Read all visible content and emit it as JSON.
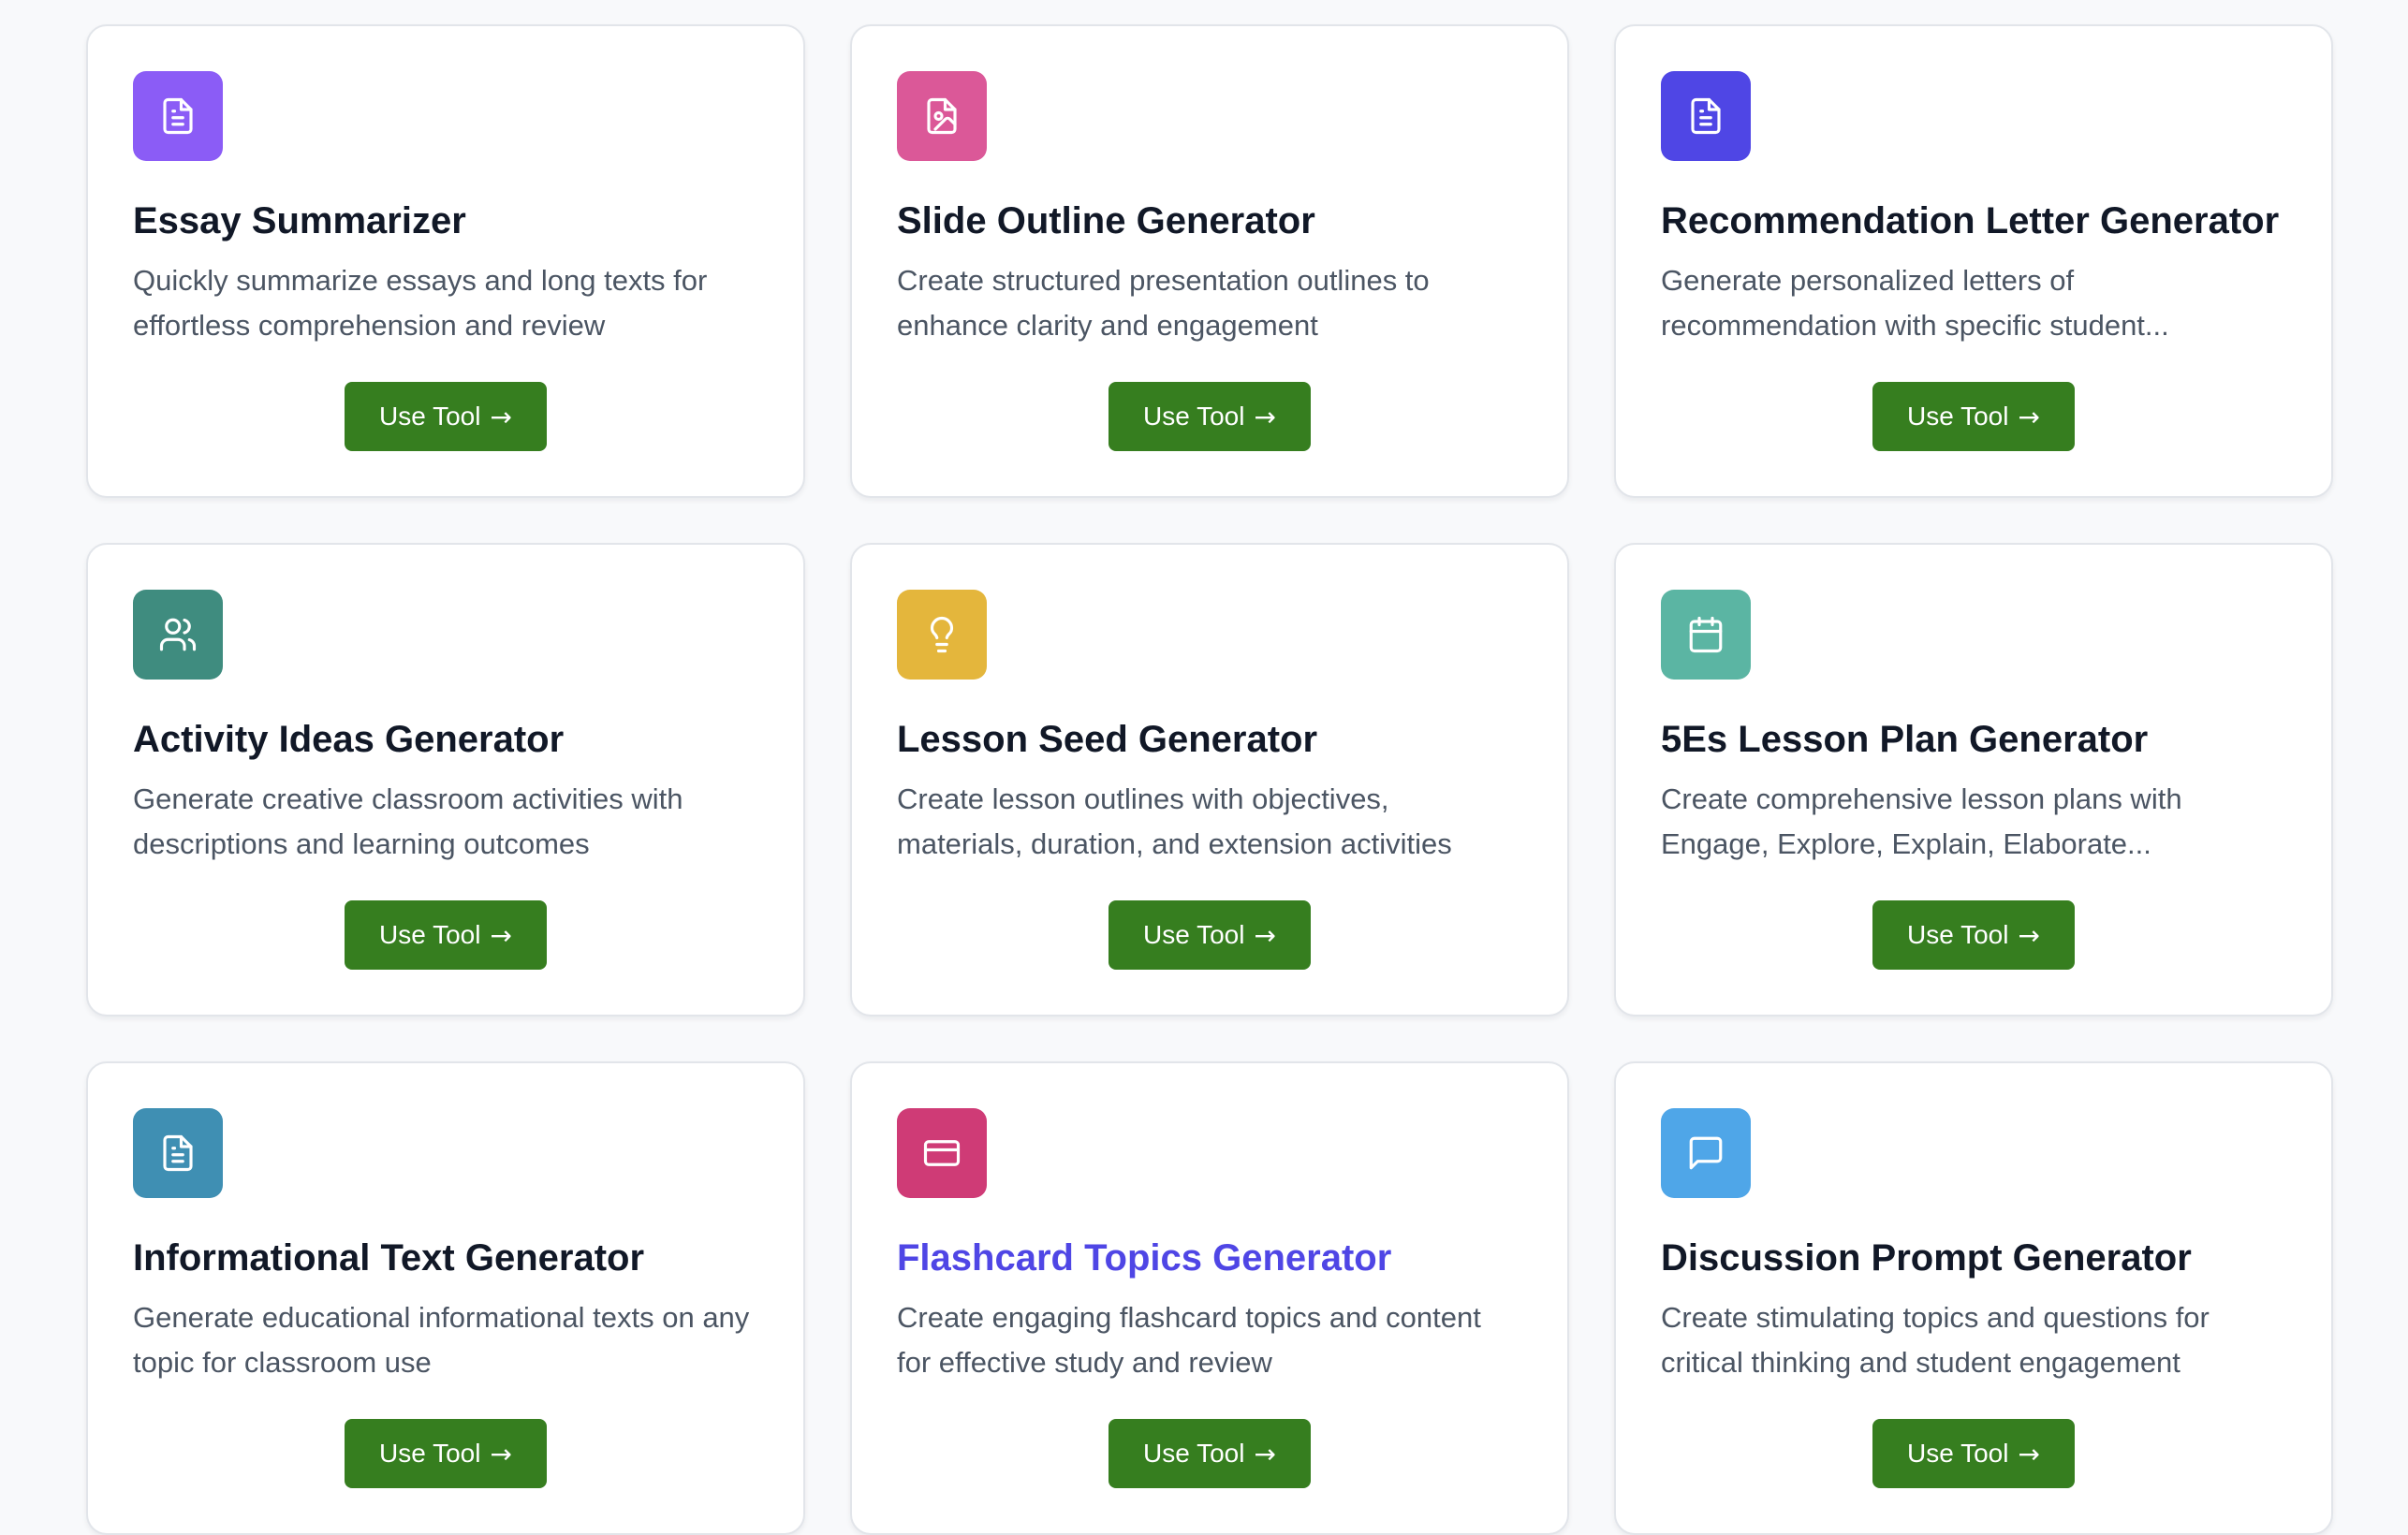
{
  "cards": [
    {
      "title": "Essay Summarizer",
      "description": "Quickly summarize essays and long texts for effortless comprehension and review",
      "button_label": "Use Tool",
      "button_arrow": "→",
      "icon": "file-text-icon",
      "icon_color": "#8b5cf6"
    },
    {
      "title": "Slide Outline Generator",
      "description": "Create structured presentation outlines to enhance clarity and engagement",
      "button_label": "Use Tool",
      "button_arrow": "→",
      "icon": "file-image-icon",
      "icon_color": "#db5898"
    },
    {
      "title": "Recommendation Letter Generator",
      "description": "Generate personalized letters of recommendation with specific student...",
      "button_label": "Use Tool",
      "button_arrow": "→",
      "icon": "file-text-icon",
      "icon_color": "#4f46e5"
    },
    {
      "title": "Activity Ideas Generator",
      "description": "Generate creative classroom activities with descriptions and learning outcomes",
      "button_label": "Use Tool",
      "button_arrow": "→",
      "icon": "users-icon",
      "icon_color": "#3f8c7f"
    },
    {
      "title": "Lesson Seed Generator",
      "description": "Create lesson outlines with objectives, materials, duration, and extension activities",
      "button_label": "Use Tool",
      "button_arrow": "→",
      "icon": "lightbulb-icon",
      "icon_color": "#e4b63c"
    },
    {
      "title": "5Es Lesson Plan Generator",
      "description": "Create comprehensive lesson plans with Engage, Explore, Explain, Elaborate...",
      "button_label": "Use Tool",
      "button_arrow": "→",
      "icon": "calendar-icon",
      "icon_color": "#5bb5a3"
    },
    {
      "title": "Informational Text Generator",
      "description": "Generate educational informational texts on any topic for classroom use",
      "button_label": "Use Tool",
      "button_arrow": "→",
      "icon": "file-text-icon",
      "icon_color": "#3f8fb3"
    },
    {
      "title": "Flashcard Topics Generator",
      "description": "Create engaging flashcard topics and content for effective study and review",
      "button_label": "Use Tool",
      "button_arrow": "→",
      "icon": "credit-card-icon",
      "icon_color": "#cf3b76",
      "highlighted": true
    },
    {
      "title": "Discussion Prompt Generator",
      "description": "Create stimulating topics and questions for critical thinking and student engagement",
      "button_label": "Use Tool",
      "button_arrow": "→",
      "icon": "message-square-icon",
      "icon_color": "#4fa6e8"
    }
  ],
  "theme": {
    "button_color": "#367e1f",
    "highlight_title_color": "#4f46e5"
  }
}
